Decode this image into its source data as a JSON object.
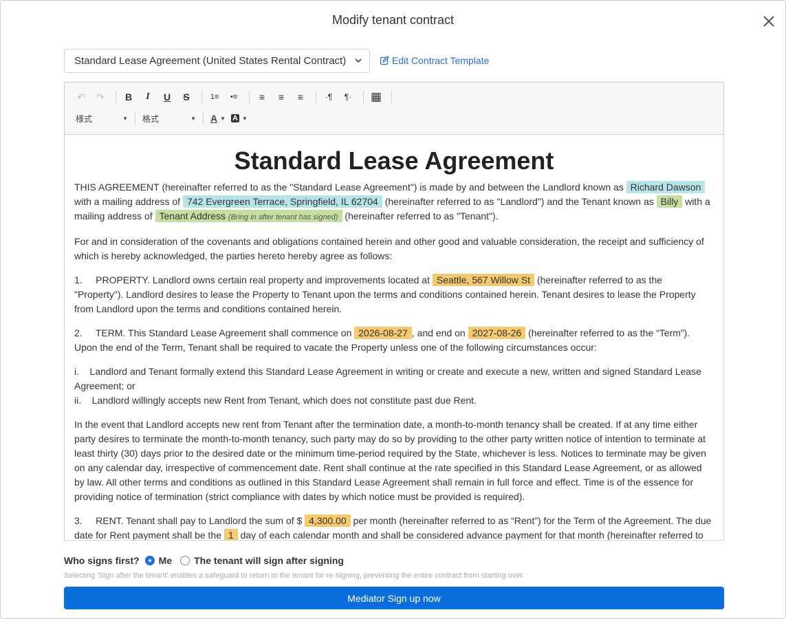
{
  "modal": {
    "title": "Modify tenant contract"
  },
  "template": {
    "selected": "Standard Lease Agreement (United States Rental Contract)",
    "edit_link": "Edit Contract Template"
  },
  "toolbar": {
    "style_combo": "様式",
    "format_combo": "格式",
    "buttons": {
      "undo": "↶",
      "redo": "↷",
      "bold": "B",
      "italic": "I",
      "underline": "U",
      "strike": "S",
      "ol": "1≡",
      "ul": "•≡",
      "left": "≡",
      "center": "≡",
      "right": "≡",
      "ltr": "·¶",
      "rtl": "¶·",
      "table": "▦",
      "text_color": "A",
      "bg_color": "A"
    }
  },
  "document": {
    "title": "Standard Lease Agreement",
    "p1": {
      "a": "THIS AGREEMENT (hereinafter referred to as the \"Standard Lease Agreement\") is made by and between the Landlord known as ",
      "landlord_name": "Richard Dawson",
      "b": " with a mailing address of ",
      "landlord_address": "742 Evergreen Terrace, Springfield, IL 62704",
      "c": " (hereinafter referred to as \"Landlord\") and the Tenant known as ",
      "tenant_name": "Billy",
      "d": " with a mailing address of ",
      "tenant_address": "Tenant Address",
      "tenant_address_hint": "(Bring in after tenant has signed)",
      "e": " (hereinafter referred to as \"Tenant\")."
    },
    "p2": "For and in consideration of the covenants and obligations contained herein and other good and valuable consideration, the receipt and sufficiency of which is hereby acknowledged, the parties hereto hereby agree as follows:",
    "p3": {
      "a": "1.     PROPERTY. Landlord owns certain real property and improvements located at ",
      "property": "Seattle, 567 Willow St",
      "b": " (hereinafter referred to as the \"Property\"). Landlord desires to lease the Property to Tenant upon the terms and conditions contained herein. Tenant desires to lease the Property from Landlord upon the terms and conditions contained herein."
    },
    "p4": {
      "a": "2.     TERM. This Standard Lease Agreement shall commence on ",
      "start": "2026-08-27",
      "b": ", and end on ",
      "end": "2027-08-26",
      "c": " (hereinafter referred to as the “Term”). Upon the end of the Term, Tenant shall be required to vacate the Property unless one of the following circumstances occur:"
    },
    "p5_i": "i.    Landlord and Tenant formally extend this Standard Lease Agreement in writing or create and execute a new, written and signed Standard Lease Agreement; or",
    "p5_ii": "ii.    Landlord willingly accepts new Rent from Tenant, which does not constitute past due Rent.",
    "p6": "In the event that Landlord accepts new rent from Tenant after the termination date, a month-to-month tenancy shall be created. If at any time either party desires to terminate the month-to-month tenancy, such party may do so by providing to the other party written notice of intention to terminate at least thirty (30) days prior to the desired date or the minimum time-period required by the State, whichever is less. Notices to terminate may be given on any calendar day, irrespective of commencement date. Rent shall continue at the rate specified in this Standard Lease Agreement, or as allowed by law. All other terms and conditions as outlined in this Standard Lease Agreement shall remain in full force and effect. Time is of the essence for providing notice of termination (strict compliance with dates by which notice must be provided is required).",
    "p7": {
      "a": "3.     RENT. Tenant shall pay to Landlord the sum of $ ",
      "amount": "4,300.00",
      "b": " per month (hereinafter referred to as “Rent”) for the Term of the Agreement. The due date for Rent payment shall be the ",
      "day": "1",
      "c": " day of each calendar month and shall be considered advance payment for that month (hereinafter referred to"
    }
  },
  "signing": {
    "question": "Who signs first?",
    "option_me": "Me",
    "option_tenant": "The tenant will sign after signing",
    "selected": "Me",
    "note": "Selecting 'Sign after the tenant' enables a safeguard to return to the tenant for re-signing, preventing the entire contract from starting over.",
    "button": "Mediator Sign up now"
  },
  "colors": {
    "primary": "#0a6edc",
    "highlight_blue": "#b7e4ea",
    "highlight_green": "#c5dfa0",
    "highlight_orange": "#f5c96e"
  }
}
